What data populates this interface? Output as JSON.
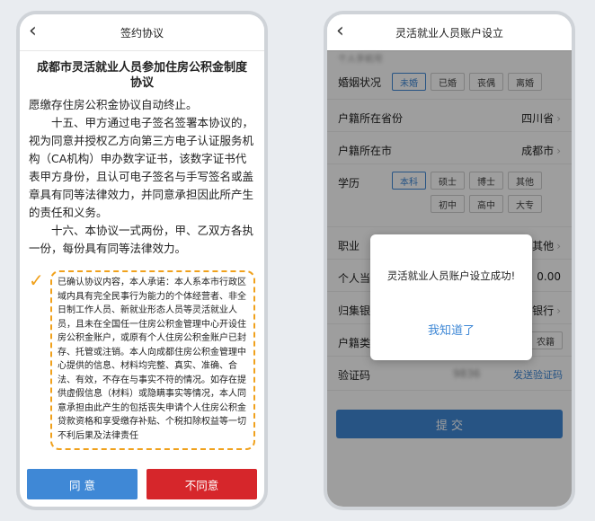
{
  "left": {
    "header_title": "签约协议",
    "doc_title": "成都市灵活就业人员参加住房公积金制度协议",
    "line_top": "愿缴存住房公积金协议自动终止。",
    "clause15": "十五、甲方通过电子签名签署本协议的，视为同意并授权乙方向第三方电子认证服务机构（CA机构）申办数字证书，该数字证书代表甲方身份，且认可电子签名与手写签名或盖章具有同等法律效力，并同意承担因此所产生的责任和义务。",
    "clause16": "十六、本协议一式两份，甲、乙双方各执一份，每份具有同等法律效力。",
    "confirm_text": "已确认协议内容，本人承诺：本人系本市行政区域内具有完全民事行为能力的个体经营者、非全日制工作人员、新就业形态人员等灵活就业人员，且未在全国任一住房公积金管理中心开设住房公积金账户，或原有个人住房公积金账户已封存、托管或注销。本人向成都住房公积金管理中心提供的信息、材料均完整、真实、准确、合法、有效，不存在与事实不符的情况。如存在提供虚假信息（材料）或隐瞒事实等情况，本人同意承担由此产生的包括丧失申请个人住房公积金贷款资格和享受缴存补贴、个税扣除权益等一切不利后果及法律责任",
    "agree_label": "同 意",
    "disagree_label": "不同意"
  },
  "right": {
    "header_title": "灵活就业人员账户设立",
    "ghost_row": "个人手机号",
    "marital_label": "婚姻状况",
    "marital_options": [
      "未婚",
      "已婚",
      "丧偶",
      "离婚"
    ],
    "province_label": "户籍所在省份",
    "province_value": "四川省",
    "city_label": "户籍所在市",
    "city_value": "成都市",
    "edu_label": "学历",
    "edu_options": [
      "本科",
      "硕士",
      "博士",
      "其他",
      "初中",
      "高中",
      "大专"
    ],
    "job_label": "职业",
    "job_value": "其他",
    "income_label": "个人当",
    "income_value": "0.00",
    "bank_label": "归集银",
    "bank_value": "银行",
    "hukou_label": "户籍类",
    "hukou_value": "农籍",
    "code_label": "验证码",
    "code_value": "9836",
    "send_code": "发送验证码",
    "submit": "提 交",
    "modal_message": "灵活就业人员账户设立成功!",
    "modal_button": "我知道了"
  }
}
